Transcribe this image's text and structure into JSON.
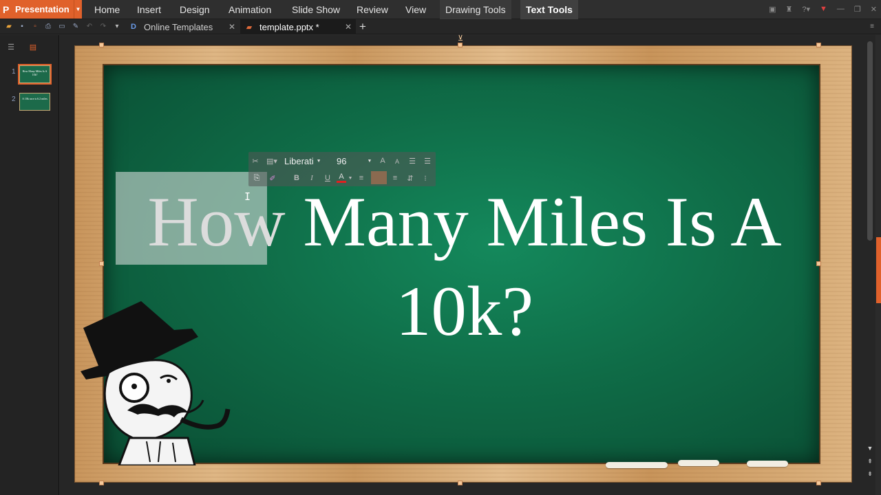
{
  "app": {
    "name": "Presentation",
    "menus": [
      "Home",
      "Insert",
      "Design",
      "Animation",
      "Slide Show",
      "Review",
      "View"
    ],
    "context_menus": [
      "Drawing Tools"
    ],
    "active_menu": "Text Tools"
  },
  "tabs": {
    "online": "Online Templates",
    "document": "template.pptx *",
    "new_tab": "+"
  },
  "slides": [
    {
      "number": "1",
      "thumb_text": "How Many Miles Is A 10k?"
    },
    {
      "number": "2",
      "thumb_text": "A 10k race is 6.2 miles"
    }
  ],
  "mini_toolbar": {
    "font_name": "Liberati",
    "font_size": "96",
    "bold": "B",
    "italic": "I",
    "underline": "U",
    "font_color_letter": "A",
    "accent_color": "#e02020"
  },
  "slide": {
    "title_word1": "How",
    "title_rest": " Many Miles Is A",
    "title_line2": "10k?",
    "board_color": "#0f6c47",
    "frame_color": "#d6a86f"
  },
  "colors": {
    "accent": "#e0612b",
    "selection": "#e6e6e6"
  }
}
